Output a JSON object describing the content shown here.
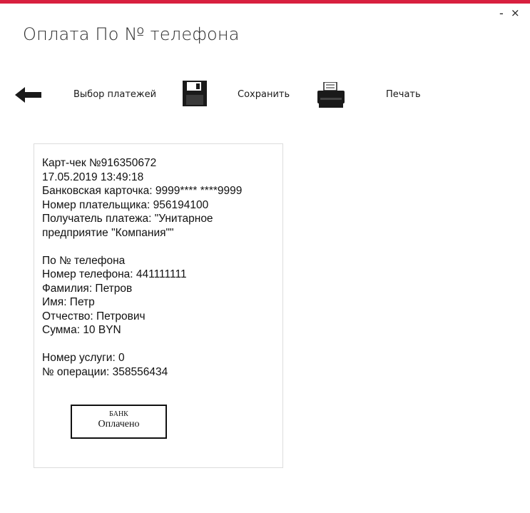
{
  "window": {
    "title": "Оплата По № телефона",
    "minimize_label": "-",
    "close_label": "×",
    "accent_color": "#d81f3f"
  },
  "toolbar": {
    "back_icon": "arrow-left-icon",
    "back_label": "Выбор платежей",
    "save_icon": "floppy-disk-icon",
    "save_label": "Сохранить",
    "print_icon": "printer-icon",
    "print_label": "Печать"
  },
  "receipt": {
    "line1": "Карт-чек №916350672",
    "line2": "17.05.2019 13:49:18",
    "line3": "Банковская карточка: 9999**** ****9999",
    "line4": "Номер плательщика: 956194100",
    "line5": "Получатель платежа: \"Унитарное",
    "line6": "предприятие \"Компания\"\"",
    "line7": "По № телефона",
    "line8": "Номер телефона: 441111111",
    "line9": "Фамилия: Петров",
    "line10": "Имя: Петр",
    "line11": "Отчество: Петрович",
    "line12": "Сумма: 10 BYN",
    "line13": "Номер услуги: 0",
    "line14": "№ операции: 358556434",
    "stamp_top": "БАНК",
    "stamp_bottom": "Оплачено"
  }
}
